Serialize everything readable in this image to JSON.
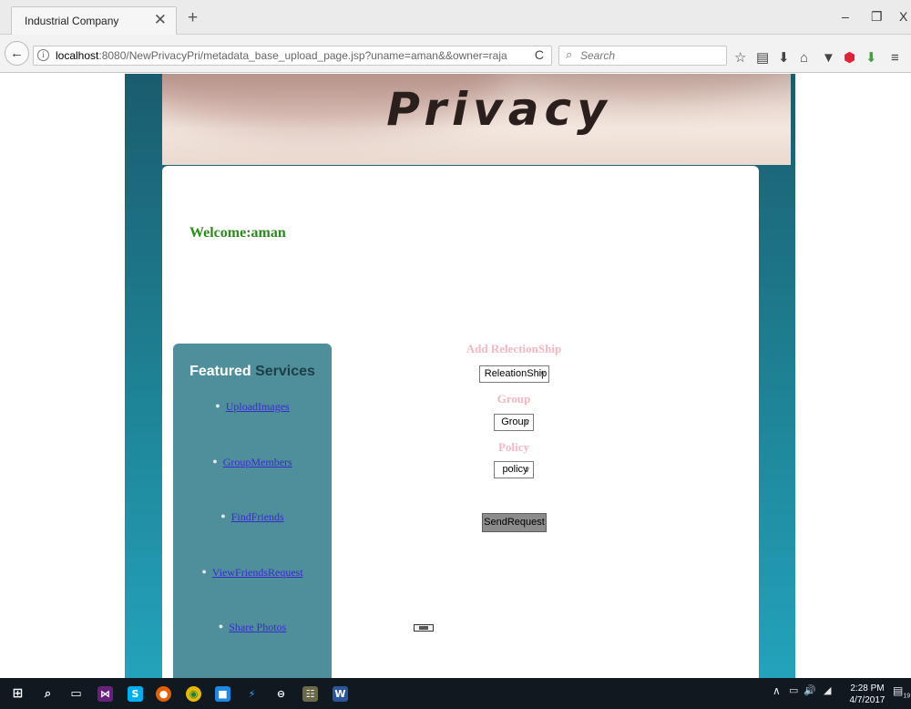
{
  "browser": {
    "tab_title": "Industrial Company",
    "tab_close": "✕",
    "new_tab": "+",
    "window_controls": {
      "minimize": "–",
      "maximize": "❐",
      "close": "X"
    },
    "back_icon": "back-arrow-icon",
    "url_host": "localhost",
    "url_rest": ":8080/NewPrivacyPri/metadata_base_upload_page.jsp?uname=aman&&owner=raja",
    "reload_glyph": "C",
    "search_placeholder": "Search",
    "toolbar_icons": [
      "star-icon",
      "reading-list-icon",
      "download-icon",
      "home-icon",
      "pocket-icon",
      "shield-icon",
      "addon-icon",
      "menu-icon"
    ]
  },
  "page": {
    "banner_title": "Privacy",
    "welcome": "Welcome:aman",
    "sidebar": {
      "heading_part1": "Featured",
      "heading_part2": "Services",
      "items": [
        {
          "label": "UploadImages"
        },
        {
          "label": "GroupMembers"
        },
        {
          "label": "FindFriends"
        },
        {
          "label": "ViewFriendsRequest"
        },
        {
          "label": "Share Photos"
        }
      ]
    },
    "form": {
      "relationship_label": "Add RelectionShip",
      "relationship_value": "ReleationShip",
      "group_label": "Group",
      "group_value": "Group",
      "policy_label": "Policy",
      "policy_value": "policy",
      "send_label": "SendRequest"
    }
  },
  "taskbar": {
    "clock_time": "2:28 PM",
    "clock_date": "4/7/2017",
    "notification_count": "19",
    "accent": "#101820"
  }
}
